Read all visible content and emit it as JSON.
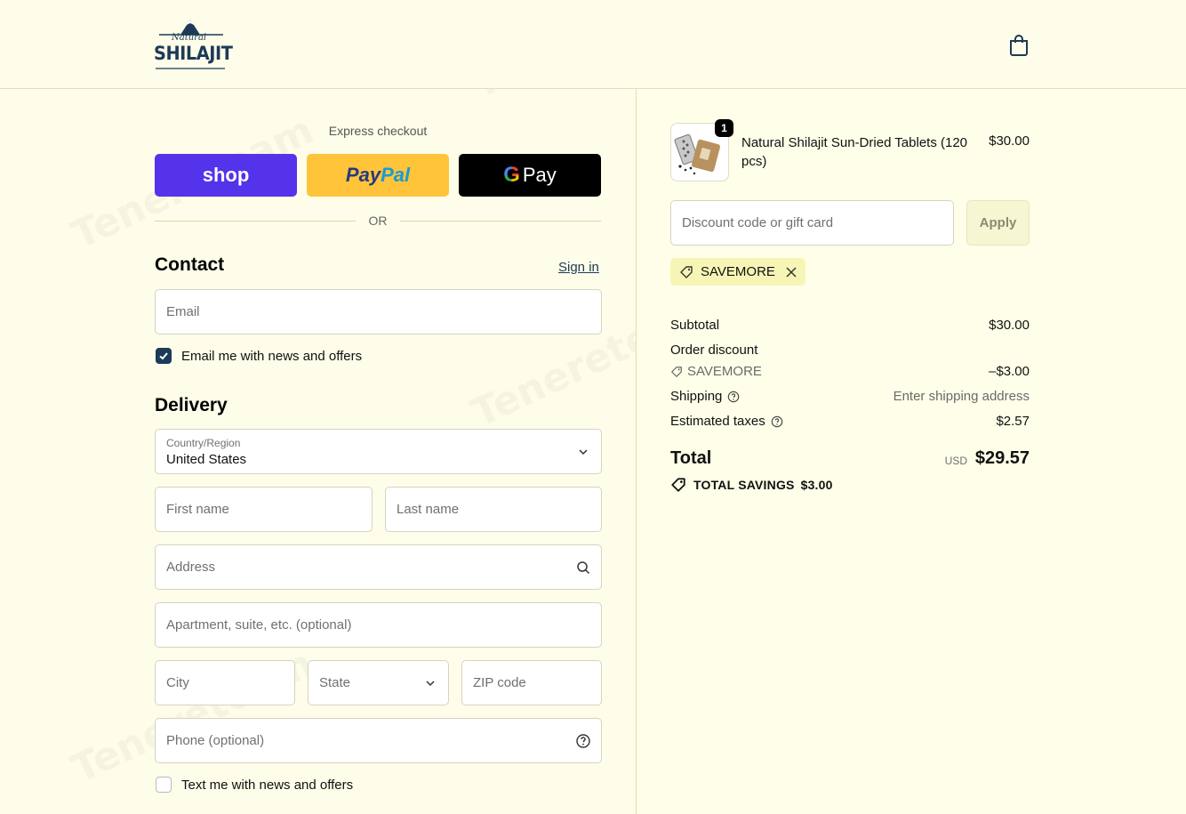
{
  "brand": {
    "script_text": "Natural",
    "name": "SHILAJIT"
  },
  "watermark": "Tenereteam",
  "express": {
    "title": "Express checkout",
    "buttons": {
      "shop": "shop",
      "paypal_a": "Pay",
      "paypal_b": "Pal",
      "gpay_g": "G",
      "gpay_text": "Pay"
    },
    "or": "OR"
  },
  "contact": {
    "heading": "Contact",
    "sign_in": "Sign in",
    "email_placeholder": "Email",
    "newsletter_label": "Email me with news and offers",
    "newsletter_checked": true
  },
  "delivery": {
    "heading": "Delivery",
    "country_label": "Country/Region",
    "country_value": "United States",
    "first_name": "First name",
    "last_name": "Last name",
    "address": "Address",
    "apartment": "Apartment, suite, etc. (optional)",
    "city": "City",
    "state": "State",
    "zip": "ZIP code",
    "phone": "Phone (optional)",
    "sms_label": "Text me with news and offers",
    "sms_checked": false
  },
  "order": {
    "item": {
      "name": "Natural Shilajit Sun-Dried Tablets (120 pcs)",
      "price": "$30.00",
      "quantity": "1"
    },
    "discount_placeholder": "Discount code or gift card",
    "apply": "Apply",
    "applied_code": "SAVEMORE",
    "subtotal_label": "Subtotal",
    "subtotal_value": "$30.00",
    "order_discount_label": "Order discount",
    "order_discount_code": "SAVEMORE",
    "order_discount_value": "–$3.00",
    "shipping_label": "Shipping",
    "shipping_value": "Enter shipping address",
    "taxes_label": "Estimated taxes",
    "taxes_value": "$2.57",
    "total_label": "Total",
    "total_currency": "USD",
    "total_value": "$29.57",
    "savings_label": "TOTAL SAVINGS",
    "savings_value": "$3.00"
  },
  "colors": {
    "background": "#fdfde9",
    "brand_navy": "#1d3a57",
    "shop_purple": "#5433eb",
    "paypal_yellow": "#ffc439",
    "chip_yellow": "#f7f5b5"
  }
}
